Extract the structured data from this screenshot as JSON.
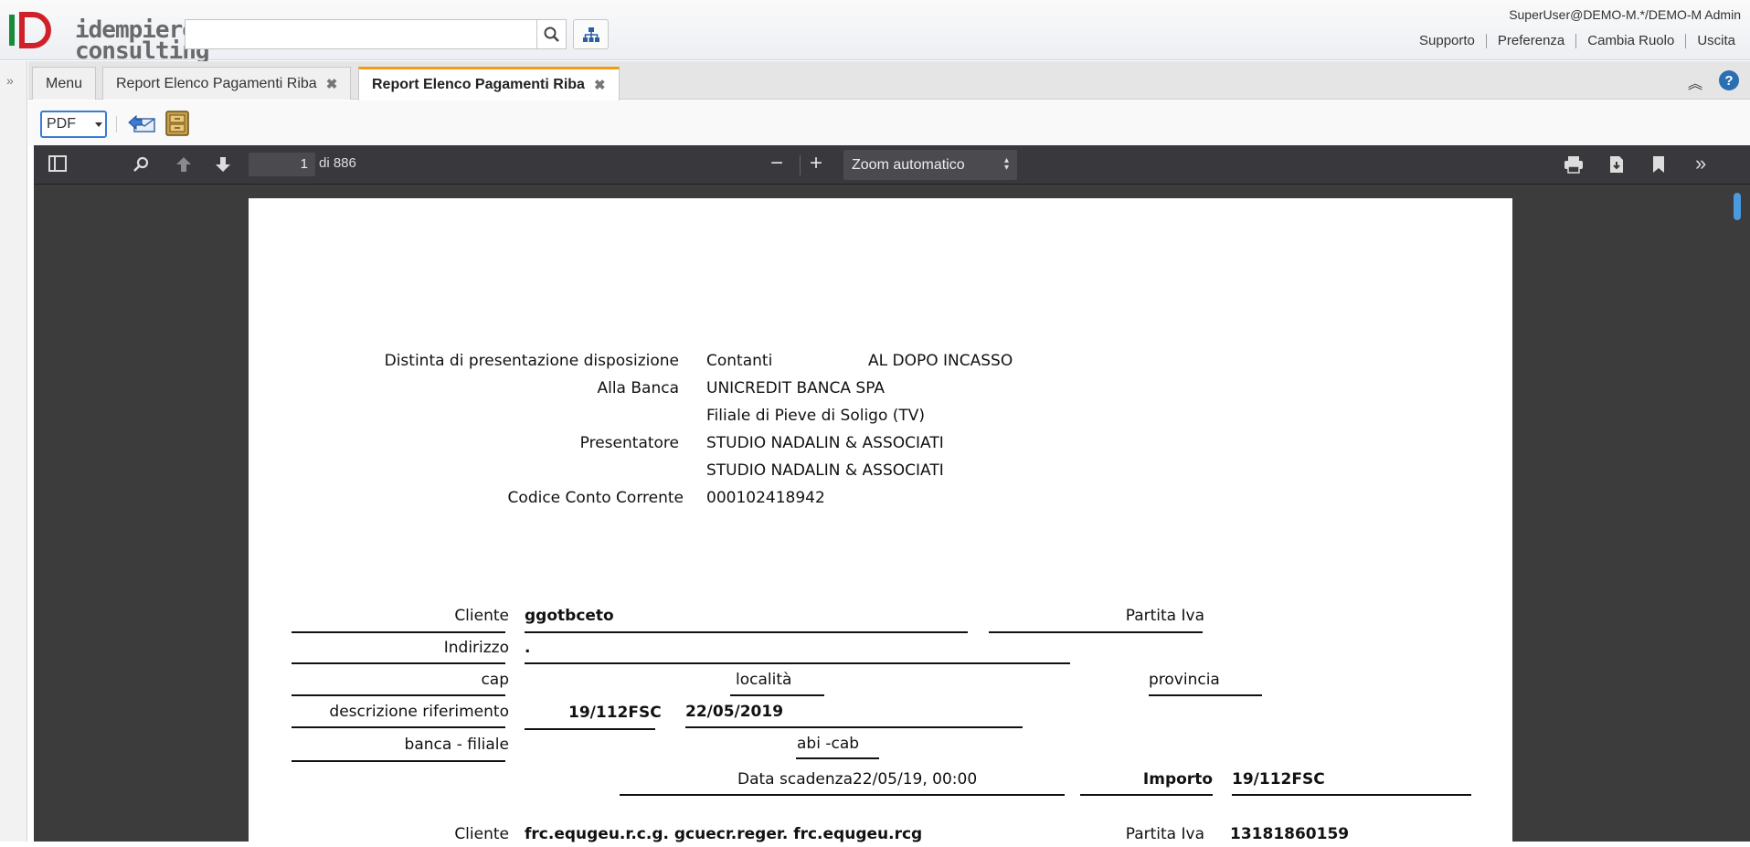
{
  "header": {
    "logo_text_line1": "idempiere",
    "logo_text_line2": "consulting",
    "user": "SuperUser@DEMO-M.*/DEMO-M Admin",
    "links": [
      "Supporto",
      "Preferenza",
      "Cambia Ruolo",
      "Uscita"
    ],
    "search_value": ""
  },
  "tabs": {
    "menu": "Menu",
    "tab1": "Report Elenco Pagamenti Riba",
    "tab2": "Report Elenco Pagamenti Riba",
    "close": "✖"
  },
  "toolbar": {
    "format": "PDF"
  },
  "viewer": {
    "page_current": "1",
    "page_total": "di 886",
    "zoom": "Zoom automatico"
  },
  "document": {
    "distinta_label": "Distinta di presentazione disposizione",
    "distinta_value": "Contanti",
    "distinta_value2": "AL DOPO INCASSO",
    "banca_label": "Alla Banca",
    "banca_value": "UNICREDIT BANCA SPA",
    "filiale_value": "Filiale di Pieve di Soligo (TV)",
    "presentatore_label": "Presentatore",
    "presentatore_value1": "STUDIO NADALIN & ASSOCIATI",
    "presentatore_value2": "STUDIO NADALIN & ASSOCIATI",
    "conto_label": "Codice Conto Corrente",
    "conto_value": "000102418942",
    "record1": {
      "cliente_label": "Cliente",
      "cliente_value": "ggotbceto",
      "piva_label": "Partita Iva",
      "piva_value": "",
      "indirizzo_label": "Indirizzo",
      "indirizzo_value": ".",
      "cap_label": "cap",
      "localita_label": "località",
      "provincia_label": "provincia",
      "descr_label": "descrizione riferimento",
      "descr_value1": "19/112FSC",
      "descr_value2": "22/05/2019",
      "banca_label": "banca - filiale",
      "abi_label": "abi -cab",
      "scadenza_label": "Data scadenza22/05/19, 00:00",
      "importo_label": "Importo",
      "importo_value": "19/112FSC"
    },
    "record2": {
      "cliente_label": "Cliente",
      "cliente_value": "frc.equgeu.r.c.g. gcuecr.reger. frc.equgeu.rcg",
      "piva_label": "Partita Iva",
      "piva_value": "13181860159"
    }
  }
}
